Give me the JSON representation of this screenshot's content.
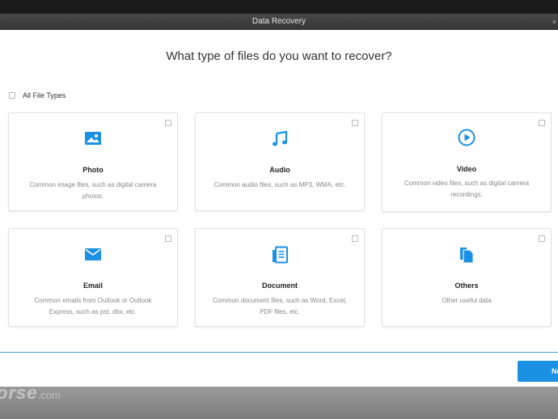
{
  "window": {
    "title": "Data Recovery"
  },
  "headline": "What type of files do you want to recover?",
  "all_file_types": {
    "label": "All File Types",
    "checked": false
  },
  "cards": [
    {
      "title": "Photo",
      "desc": "Common image files, such as digital camera photos.",
      "icon": "image-icon"
    },
    {
      "title": "Audio",
      "desc": "Common audio files, such as MP3, WMA, etc.",
      "icon": "music-note-icon"
    },
    {
      "title": "Video",
      "desc": "Common video files, such as digital camera recordings.",
      "icon": "play-circle-icon"
    },
    {
      "title": "Email",
      "desc": "Common emails from Outlook or Outlook Express, such as pst, dbx, etc.",
      "icon": "envelope-icon"
    },
    {
      "title": "Document",
      "desc": "Common document files, such as Word, Excel, PDF files, etc.",
      "icon": "document-icon"
    },
    {
      "title": "Others",
      "desc": "Other useful data",
      "icon": "files-icon"
    }
  ],
  "footer": {
    "next_label": "Ne"
  },
  "watermark": {
    "main": "orse",
    "suffix": ".com"
  },
  "colors": {
    "accent": "#1a91e3",
    "titlebar": "#3a3a3a"
  }
}
